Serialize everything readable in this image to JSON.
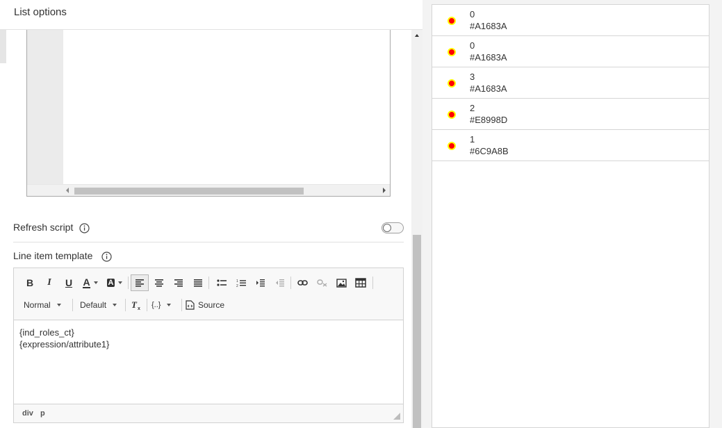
{
  "panel": {
    "title": "List options"
  },
  "refresh": {
    "label": "Refresh script",
    "enabled": false
  },
  "template": {
    "label": "Line item template",
    "toolbar": {
      "bold": "B",
      "italic": "I",
      "underline": "U",
      "text_color": "A",
      "bg_color": "A",
      "format": "Normal",
      "font": "Default",
      "expression": "{..}",
      "source": "Source"
    },
    "content": {
      "line1": "{ind_roles_ct}",
      "line2": "{expression/attribute1}"
    },
    "status_path": [
      "div",
      "p"
    ]
  },
  "preview_list": [
    {
      "value": "0",
      "color_text": "#A1683A"
    },
    {
      "value": "0",
      "color_text": "#A1683A"
    },
    {
      "value": "3",
      "color_text": "#A1683A"
    },
    {
      "value": "2",
      "color_text": "#E8998D"
    },
    {
      "value": "1",
      "color_text": "#6C9A8B"
    }
  ],
  "colors": {
    "dot_fill": "#ff0000",
    "dot_stroke": "#ffff00"
  }
}
